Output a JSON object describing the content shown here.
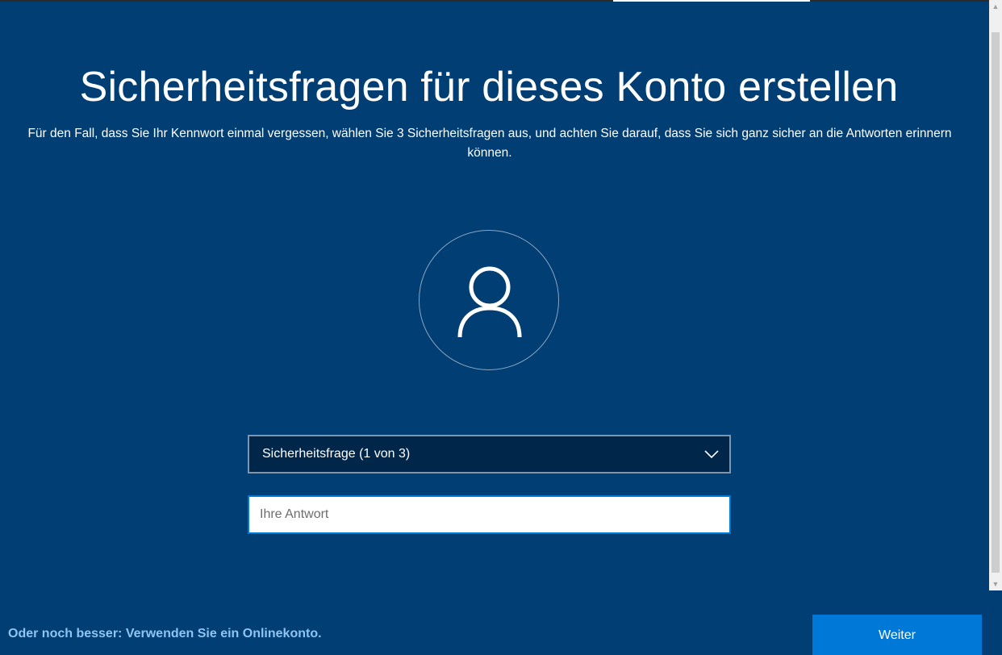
{
  "page": {
    "title": "Sicherheitsfragen für dieses Konto erstellen",
    "description": "Für den Fall, dass Sie Ihr Kennwort einmal vergessen, wählen Sie 3 Sicherheitsfragen aus, und achten Sie darauf, dass Sie sich ganz sicher an die Antworten erinnern können."
  },
  "avatar": {
    "icon": "user-icon"
  },
  "form": {
    "question_select_value": "Sicherheitsfrage (1 von 3)",
    "answer_value": "",
    "answer_placeholder": "Ihre Antwort"
  },
  "footer": {
    "online_account_link": "Oder noch besser: Verwenden Sie ein Onlinekonto.",
    "next_label": "Weiter"
  },
  "colors": {
    "background": "#003e73",
    "accent": "#0078d7",
    "link": "#8fc3f2",
    "select_background": "#002649"
  }
}
